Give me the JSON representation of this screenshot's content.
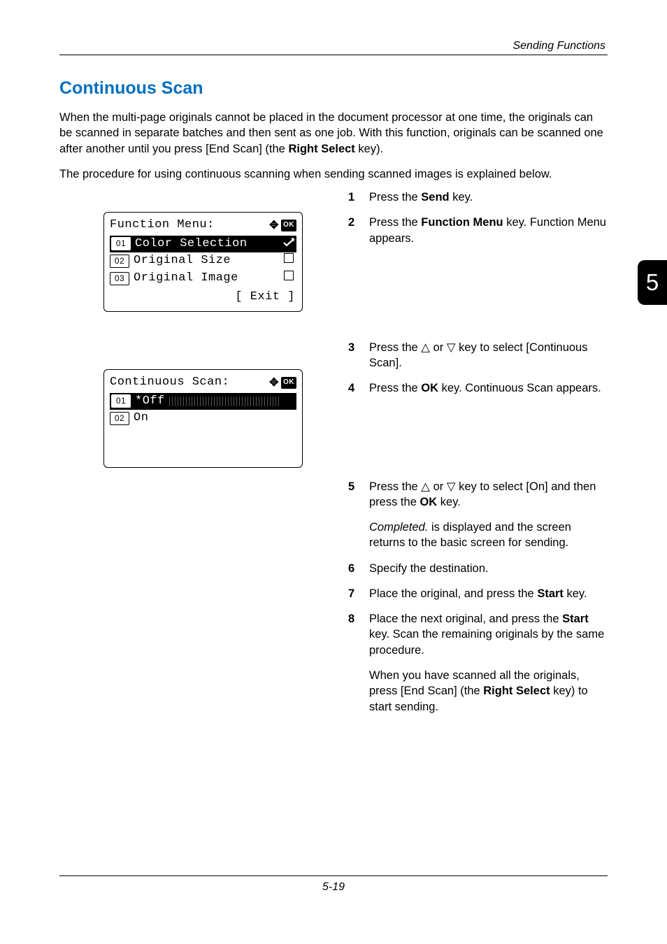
{
  "header": {
    "running": "Sending Functions"
  },
  "tab": "5",
  "title": "Continuous Scan",
  "intro": {
    "p1_a": "When the multi-page originals cannot be placed in the document processor at one time, the originals can be scanned in separate batches and then sent as one job. With this function, originals can be scanned one after another until you press [End Scan] (the ",
    "p1_b": "Right Select",
    "p1_c": " key).",
    "p2": "The procedure for using continuous scanning when sending scanned images is explained below."
  },
  "lcd1": {
    "title": "Function Menu:",
    "rows": [
      {
        "num": "01",
        "label": "Color Selection",
        "suffix": "check",
        "sel": true
      },
      {
        "num": "02",
        "label": "Original Size",
        "suffix": "box",
        "sel": false
      },
      {
        "num": "03",
        "label": "Original Image",
        "suffix": "box",
        "sel": false
      }
    ],
    "soft": "[  Exit  ]"
  },
  "lcd2": {
    "title": "Continuous Scan:",
    "rows": [
      {
        "num": "01",
        "label": "*Off",
        "sel": true
      },
      {
        "num": "02",
        "label": "On",
        "sel": false
      }
    ]
  },
  "steps": {
    "s1_a": "Press the ",
    "s1_b": "Send",
    "s1_c": " key.",
    "s2_a": "Press the ",
    "s2_b": "Function Menu",
    "s2_c": " key. Function Menu appears.",
    "s3_a": "Press the ",
    "s3_b": " or ",
    "s3_c": " key to select [Continuous Scan].",
    "s4_a": "Press the ",
    "s4_b": "OK",
    "s4_c": " key. Continuous Scan appears.",
    "s5_a": "Press the ",
    "s5_b": " or ",
    "s5_c": " key to select [On] and then press the ",
    "s5_d": "OK",
    "s5_e": " key.",
    "s5_p2_a": "Completed.",
    "s5_p2_b": " is displayed and the screen returns to the basic screen for sending.",
    "s6": "Specify the destination.",
    "s7_a": "Place the original, and press the ",
    "s7_b": "Start",
    "s7_c": " key.",
    "s8_a": "Place the next original, and press the ",
    "s8_b": "Start",
    "s8_c": " key. Scan the remaining originals by the same procedure.",
    "s8_p2_a": "When you have scanned all the originals, press [End Scan] (the ",
    "s8_p2_b": "Right Select",
    "s8_p2_c": " key) to start sending."
  },
  "glyph": {
    "up": "△",
    "down": "▽"
  },
  "footer": {
    "page": "5-19"
  }
}
